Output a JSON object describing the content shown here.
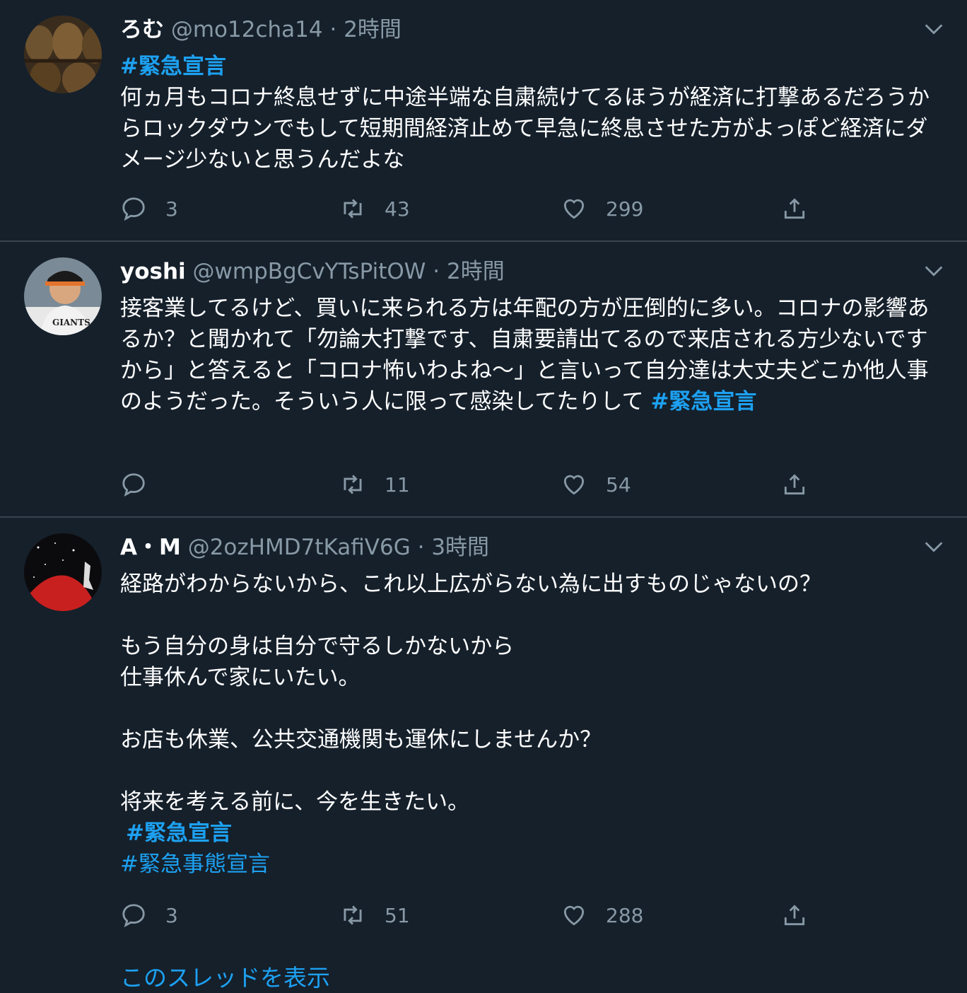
{
  "tweets": [
    {
      "name": "ろむ",
      "handle": "@mo12cha14",
      "separator": "·",
      "time": "2時間",
      "hashtag_top": "#緊急宣言",
      "text": "何ヵ月もコロナ終息せずに中途半端な自粛続けてるほうが経済に打撃あるだろうからロックダウンでもして短期間経済止めて早急に終息させた方がよっぽど経済にダメージ少ないと思うんだよな",
      "replies": "3",
      "retweets": "43",
      "likes": "299"
    },
    {
      "name": "yoshi",
      "handle": "@wmpBgCvYTsPitOW",
      "separator": "·",
      "time": "2時間",
      "text": "接客業してるけど、買いに来られる方は年配の方が圧倒的に多い。コロナの影響あるか？と聞かれて「勿論大打撃です、自粛要請出てるので来店される方少ないですから」と答えると「コロナ怖いわよね〜」と言いって自分達は大丈夫どこか他人事のようだった。そういう人に限って感染してたりして ",
      "hashtag_inline": "#緊急宣言",
      "replies": "",
      "retweets": "11",
      "likes": "54"
    },
    {
      "name": "A・M",
      "handle": "@2ozHMD7tKafiV6G",
      "separator": "·",
      "time": "3時間",
      "line1": "経路がわからないから、これ以上広がらない為に出すものじゃないの？",
      "line2": "もう自分の身は自分で守るしかないから",
      "line3": "仕事休んで家にいたい。",
      "line4": "お店も休業、公共交通機関も運休にしませんか？",
      "line5": "将来を考える前に、今を生きたい。",
      "hashtag1": "#緊急宣言",
      "hashtag2": "#緊急事態宣言",
      "replies": "3",
      "retweets": "51",
      "likes": "288"
    }
  ],
  "thread_link": "このスレッドを表示",
  "colors": {
    "background": "#15202b",
    "link": "#1da1f2",
    "muted": "#8899a6",
    "divider": "#38444d"
  }
}
